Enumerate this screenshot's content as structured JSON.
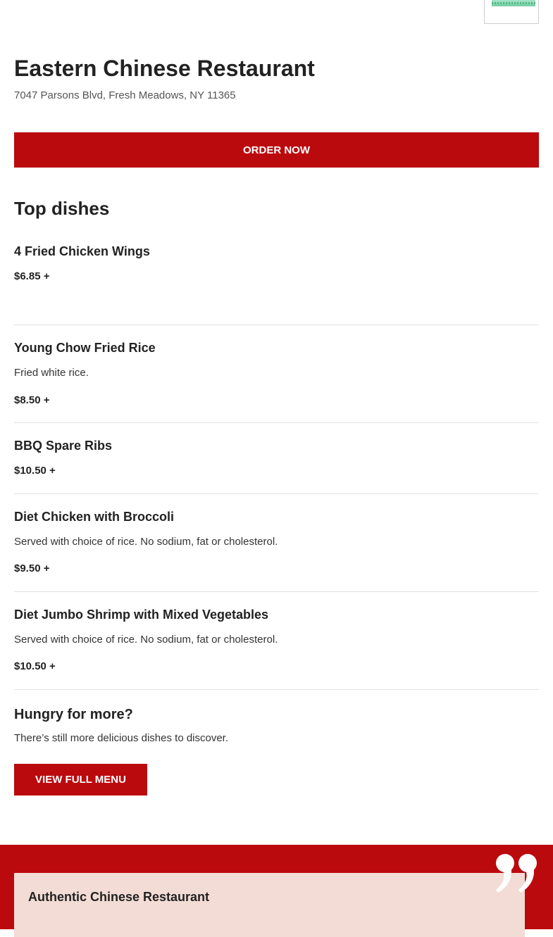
{
  "restaurant": {
    "name": "Eastern Chinese Restaurant",
    "address": "7047 Parsons Blvd, Fresh Meadows, NY 11365",
    "logo_icon": "restaurant-logo"
  },
  "actions": {
    "order_now": "ORDER NOW",
    "view_full_menu": "VIEW FULL MENU"
  },
  "top_dishes": {
    "title": "Top dishes",
    "items": [
      {
        "name": "4 Fried Chicken Wings",
        "description": "",
        "price": "$6.85 +"
      },
      {
        "name": "Young Chow Fried Rice",
        "description": "Fried white rice.",
        "price": "$8.50 +"
      },
      {
        "name": "BBQ Spare Ribs",
        "description": "",
        "price": "$10.50 +"
      },
      {
        "name": "Diet Chicken with Broccoli",
        "description": "Served with choice of rice. No sodium, fat or cholesterol.",
        "price": "$9.50 +"
      },
      {
        "name": "Diet Jumbo Shrimp with Mixed Vegetables",
        "description": "Served with choice of rice. No sodium, fat or cholesterol.",
        "price": "$10.50 +"
      }
    ]
  },
  "more": {
    "title": "Hungry for more?",
    "text": "There’s still more delicious dishes to discover."
  },
  "review": {
    "title": "Authentic Chinese Restaurant",
    "icon": "quote-icon"
  },
  "colors": {
    "accent": "#bb0a0e",
    "review_card": "#f3dcd5",
    "divider": "#e2e2e2"
  }
}
